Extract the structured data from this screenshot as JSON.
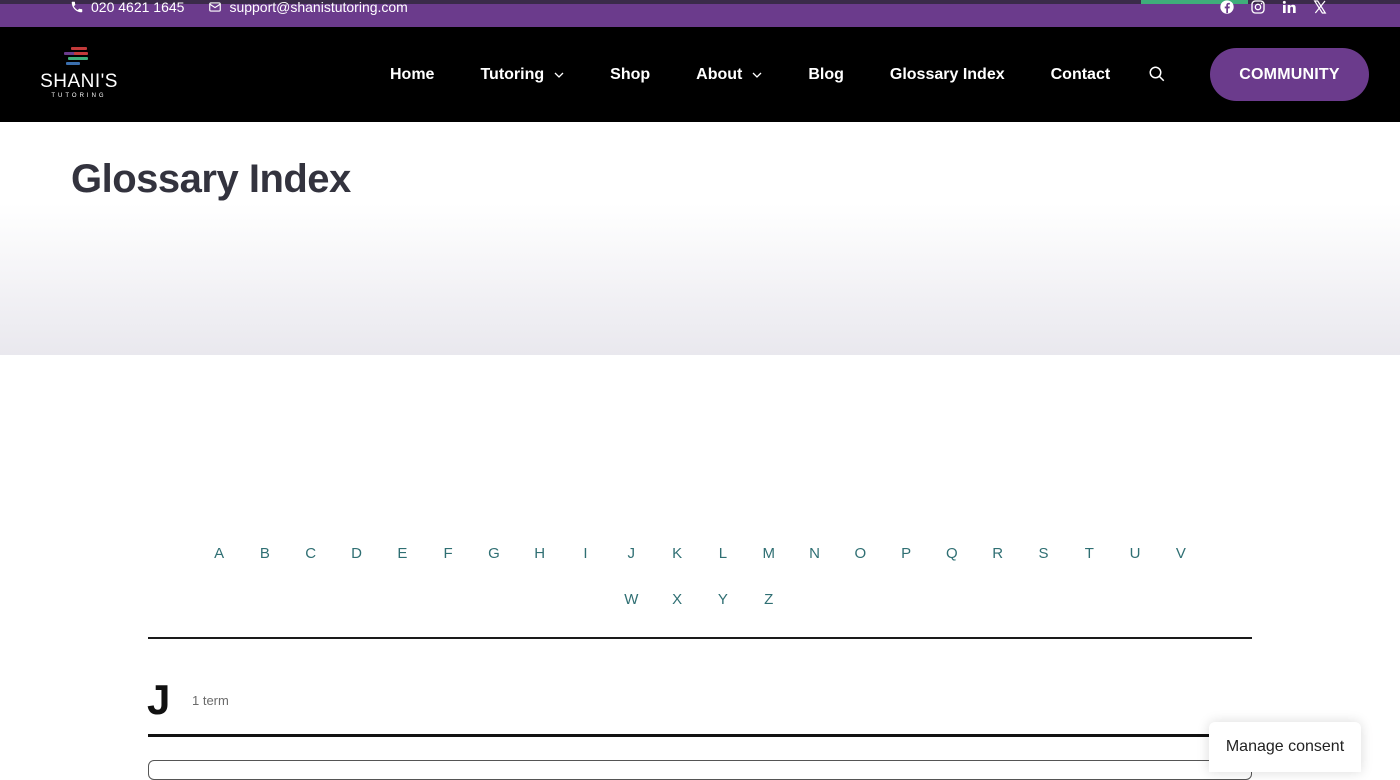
{
  "topbar": {
    "phone": "020 4621 1645",
    "email": "support@shanistutoring.com",
    "socials": [
      "facebook-icon",
      "instagram-icon",
      "linkedin-icon",
      "x-icon"
    ]
  },
  "logo": {
    "name": "SHANI'S",
    "sub": "TUTORING"
  },
  "nav": {
    "items": [
      {
        "label": "Home"
      },
      {
        "label": "Tutoring"
      },
      {
        "label": "Shop"
      },
      {
        "label": "About"
      },
      {
        "label": "Blog"
      },
      {
        "label": "Glossary Index"
      },
      {
        "label": "Contact"
      }
    ],
    "cta": "COMMUNITY"
  },
  "page": {
    "title": "Glossary Index"
  },
  "alphabet": {
    "row1": [
      "A",
      "B",
      "C",
      "D",
      "E",
      "F",
      "G",
      "H",
      "I",
      "J",
      "K",
      "L",
      "M",
      "N",
      "O",
      "P",
      "Q",
      "R",
      "S",
      "T",
      "U",
      "V"
    ],
    "row2": [
      "W",
      "X",
      "Y",
      "Z"
    ]
  },
  "section": {
    "letter": "J",
    "count": "1 term"
  },
  "consent": {
    "label": "Manage consent"
  },
  "colors": {
    "brand_purple": "#6b3b8c",
    "link_teal": "#2f6f73",
    "nav_bg": "#000000"
  }
}
